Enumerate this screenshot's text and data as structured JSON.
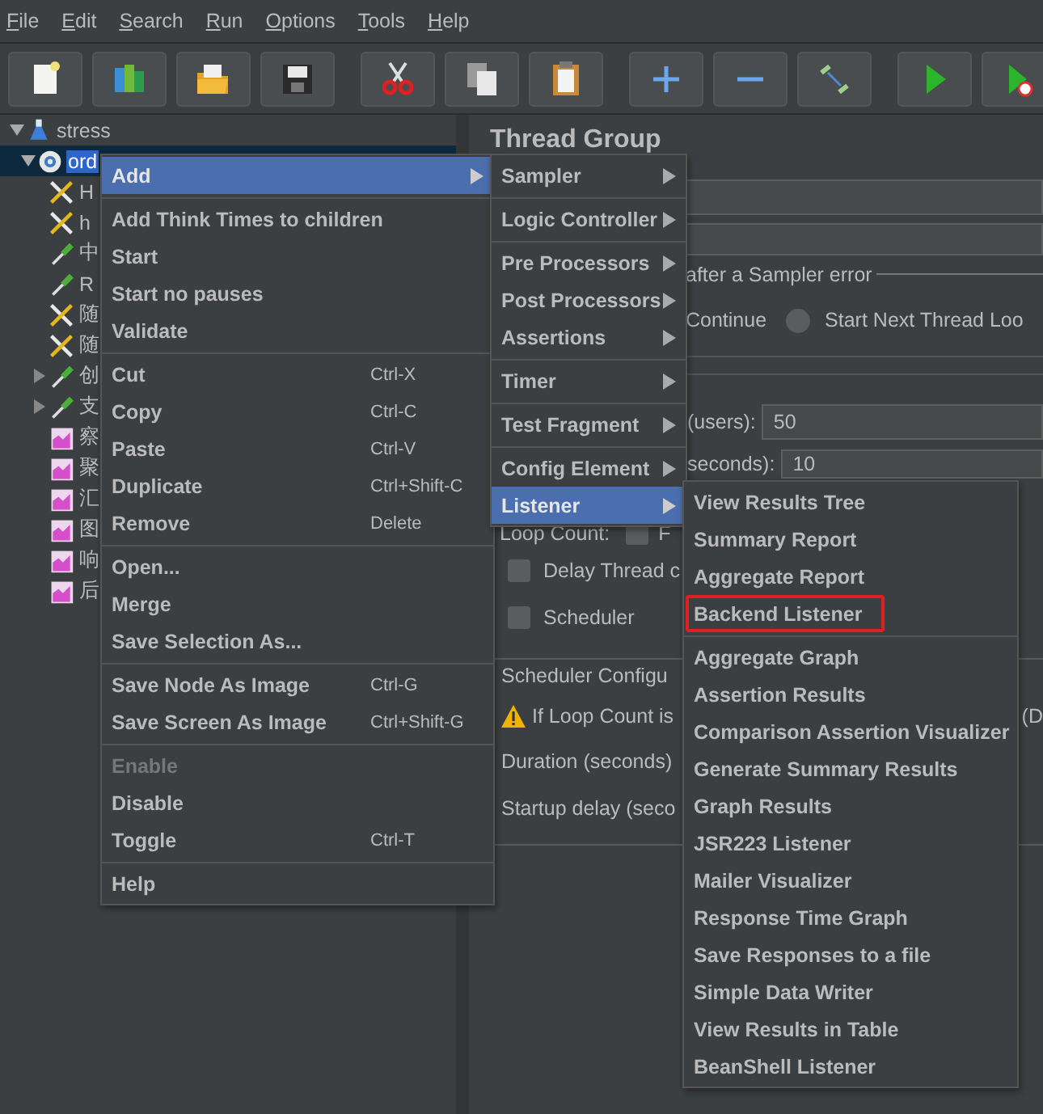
{
  "menubar": [
    "File",
    "Edit",
    "Search",
    "Run",
    "Options",
    "Tools",
    "Help"
  ],
  "toolbar": [
    {
      "kind": "new"
    },
    {
      "kind": "templates"
    },
    {
      "kind": "open"
    },
    {
      "kind": "save"
    },
    {
      "kind": "cut"
    },
    {
      "kind": "copy"
    },
    {
      "kind": "paste"
    },
    {
      "kind": "expand"
    },
    {
      "kind": "collapse"
    },
    {
      "kind": "toggle"
    },
    {
      "kind": "start"
    },
    {
      "kind": "start_no_timers"
    }
  ],
  "tree": [
    {
      "label": "stress",
      "kind": "flask",
      "expanded": true,
      "selected": false,
      "children": [
        {
          "label": "ord",
          "kind": "gear",
          "expanded": true,
          "selected": true,
          "children": [
            {
              "label": "H",
              "kind": "tool",
              "selected": false
            },
            {
              "label": "h",
              "kind": "tool",
              "selected": false
            },
            {
              "label": "中",
              "kind": "pipette",
              "selected": false
            },
            {
              "label": "R",
              "kind": "pipette",
              "selected": false
            },
            {
              "label": "随",
              "kind": "tool",
              "selected": false
            },
            {
              "label": "随",
              "kind": "tool",
              "selected": false
            },
            {
              "label": "创",
              "kind": "pipette",
              "expanded": false,
              "selected": false
            },
            {
              "label": "支",
              "kind": "pipette",
              "expanded": false,
              "selected": false
            },
            {
              "label": "察",
              "kind": "graph",
              "selected": false
            },
            {
              "label": "聚",
              "kind": "graph",
              "selected": false
            },
            {
              "label": "汇",
              "kind": "graph",
              "selected": false
            },
            {
              "label": "图",
              "kind": "graph",
              "selected": false
            },
            {
              "label": "响",
              "kind": "graph",
              "selected": false
            },
            {
              "label": "后",
              "kind": "graph",
              "selected": false
            }
          ]
        }
      ]
    }
  ],
  "panel": {
    "title": "Thread Group",
    "error_action": {
      "legend": "after a Sampler error",
      "continue_label": "Continue",
      "radio": {
        "label": "Start Next Thread Loo",
        "selected": false
      }
    },
    "thread_properties": [
      {
        "label": "(users):",
        "value": "50"
      },
      {
        "label": "seconds):",
        "value": "10"
      }
    ],
    "loop_count": {
      "label": "Loop Count:",
      "checked": false,
      "option_label": "F"
    },
    "checkboxes": [
      {
        "label": "Delay Thread c",
        "checked": false
      },
      {
        "label": "Scheduler",
        "checked": false
      }
    ],
    "scheduler_config": {
      "legend": "Scheduler Configu",
      "warning": "If Loop Count is",
      "warning_tail": "(D",
      "fields": [
        "Duration (seconds)",
        "Startup delay (seco"
      ]
    }
  },
  "context_menu": {
    "sections": [
      [
        {
          "label": "Add",
          "selected": true,
          "has_submenu": true,
          "disabled": false
        }
      ],
      [
        {
          "label": "Add Think Times to children",
          "selected": false,
          "has_submenu": false,
          "disabled": false
        },
        {
          "label": "Start",
          "selected": false,
          "has_submenu": false,
          "disabled": false
        },
        {
          "label": "Start no pauses",
          "selected": false,
          "has_submenu": false,
          "disabled": false
        },
        {
          "label": "Validate",
          "selected": false,
          "has_submenu": false,
          "disabled": false
        }
      ],
      [
        {
          "label": "Cut",
          "shortcut": "Ctrl-X",
          "selected": false,
          "has_submenu": false,
          "disabled": false
        },
        {
          "label": "Copy",
          "shortcut": "Ctrl-C",
          "selected": false,
          "has_submenu": false,
          "disabled": false
        },
        {
          "label": "Paste",
          "shortcut": "Ctrl-V",
          "selected": false,
          "has_submenu": false,
          "disabled": false
        },
        {
          "label": "Duplicate",
          "shortcut": "Ctrl+Shift-C",
          "selected": false,
          "has_submenu": false,
          "disabled": false
        },
        {
          "label": "Remove",
          "shortcut": "Delete",
          "selected": false,
          "has_submenu": false,
          "disabled": false
        }
      ],
      [
        {
          "label": "Open...",
          "selected": false,
          "has_submenu": false,
          "disabled": false
        },
        {
          "label": "Merge",
          "selected": false,
          "has_submenu": false,
          "disabled": false
        },
        {
          "label": "Save Selection As...",
          "selected": false,
          "has_submenu": false,
          "disabled": false
        }
      ],
      [
        {
          "label": "Save Node As Image",
          "shortcut": "Ctrl-G",
          "selected": false,
          "has_submenu": false,
          "disabled": false
        },
        {
          "label": "Save Screen As Image",
          "shortcut": "Ctrl+Shift-G",
          "selected": false,
          "has_submenu": false,
          "disabled": false
        }
      ],
      [
        {
          "label": "Enable",
          "selected": false,
          "has_submenu": false,
          "disabled": true
        },
        {
          "label": "Disable",
          "selected": false,
          "has_submenu": false,
          "disabled": false
        },
        {
          "label": "Toggle",
          "shortcut": "Ctrl-T",
          "selected": false,
          "has_submenu": false,
          "disabled": false
        }
      ],
      [
        {
          "label": "Help",
          "selected": false,
          "has_submenu": false,
          "disabled": false
        }
      ]
    ]
  },
  "add_submenu": {
    "sections": [
      [
        {
          "label": "Sampler",
          "selected": false,
          "has_submenu": true
        }
      ],
      [
        {
          "label": "Logic Controller",
          "selected": false,
          "has_submenu": true
        }
      ],
      [
        {
          "label": "Pre Processors",
          "selected": false,
          "has_submenu": true
        },
        {
          "label": "Post Processors",
          "selected": false,
          "has_submenu": true
        },
        {
          "label": "Assertions",
          "selected": false,
          "has_submenu": true
        }
      ],
      [
        {
          "label": "Timer",
          "selected": false,
          "has_submenu": true
        }
      ],
      [
        {
          "label": "Test Fragment",
          "selected": false,
          "has_submenu": true
        }
      ],
      [
        {
          "label": "Config Element",
          "selected": false,
          "has_submenu": true
        },
        {
          "label": "Listener",
          "selected": true,
          "has_submenu": true
        }
      ]
    ]
  },
  "listener_submenu": {
    "sections": [
      [
        {
          "label": "View Results Tree",
          "selected": false,
          "outlined": false
        },
        {
          "label": "Summary Report",
          "selected": false,
          "outlined": false
        },
        {
          "label": "Aggregate Report",
          "selected": false,
          "outlined": false
        },
        {
          "label": "Backend Listener",
          "selected": false,
          "outlined": true
        }
      ],
      [
        {
          "label": "Aggregate Graph",
          "selected": false,
          "outlined": false
        },
        {
          "label": "Assertion Results",
          "selected": false,
          "outlined": false
        },
        {
          "label": "Comparison Assertion Visualizer",
          "selected": false,
          "outlined": false
        },
        {
          "label": "Generate Summary Results",
          "selected": false,
          "outlined": false
        },
        {
          "label": "Graph Results",
          "selected": false,
          "outlined": false
        },
        {
          "label": "JSR223 Listener",
          "selected": false,
          "outlined": false
        },
        {
          "label": "Mailer Visualizer",
          "selected": false,
          "outlined": false
        },
        {
          "label": "Response Time Graph",
          "selected": false,
          "outlined": false
        },
        {
          "label": "Save Responses to a file",
          "selected": false,
          "outlined": false
        },
        {
          "label": "Simple Data Writer",
          "selected": false,
          "outlined": false
        },
        {
          "label": "View Results in Table",
          "selected": false,
          "outlined": false
        },
        {
          "label": "BeanShell Listener",
          "selected": false,
          "outlined": false
        }
      ]
    ]
  }
}
